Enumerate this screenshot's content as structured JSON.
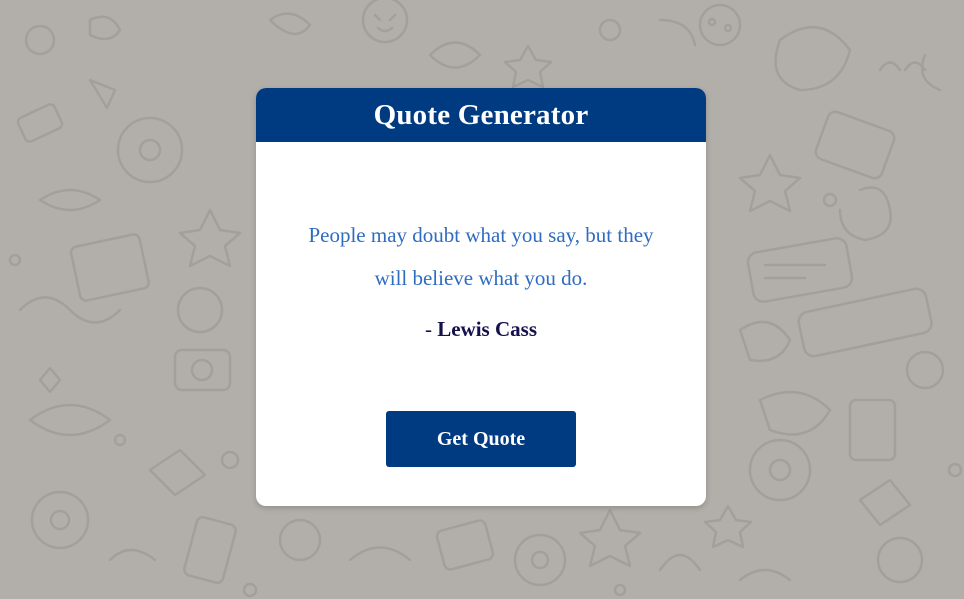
{
  "colors": {
    "background": "#b2aea9",
    "doodle": "#a19d98",
    "header": "#003b82",
    "quote_text": "#2e6cc0",
    "author_text": "#13104d",
    "button": "#003b82"
  },
  "card": {
    "title": "Quote Generator"
  },
  "quote": {
    "text": "People may doubt what you say, but they will believe what you do.",
    "author_prefix": "- ",
    "author": "Lewis Cass"
  },
  "button": {
    "label": "Get Quote"
  }
}
